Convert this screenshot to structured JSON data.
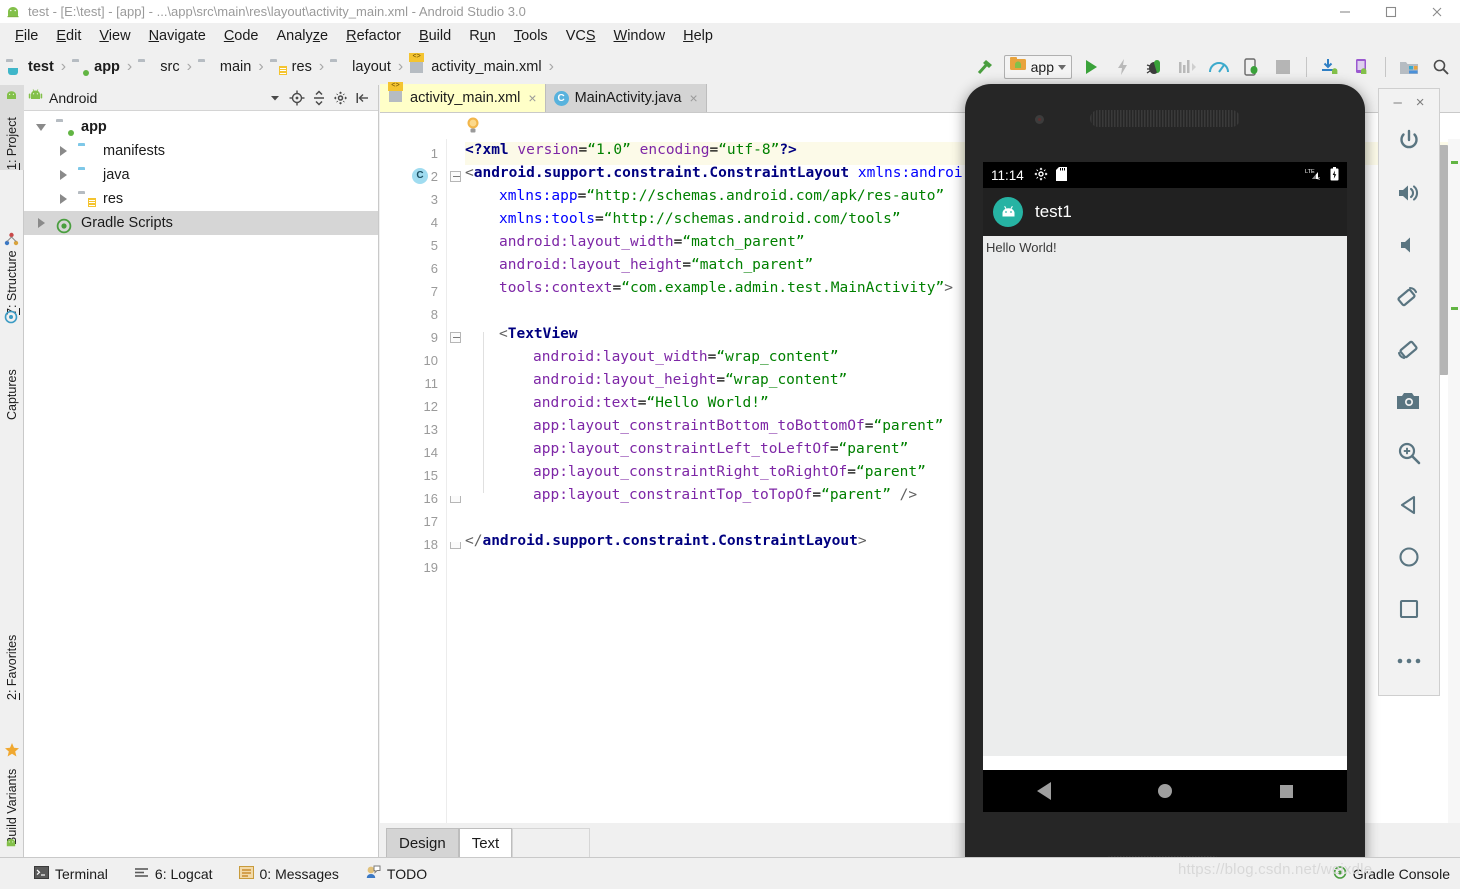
{
  "window": {
    "title": "test - [E:\\test] - [app] - ...\\app\\src\\main\\res\\layout\\activity_main.xml - Android Studio 3.0",
    "icon": "android-studio-icon",
    "controls": {
      "minimize": "minimize-icon",
      "maximize": "maximize-icon",
      "close": "close-icon"
    }
  },
  "menubar": {
    "items": [
      {
        "label": "File",
        "mnemonic": "F"
      },
      {
        "label": "Edit",
        "mnemonic": "E"
      },
      {
        "label": "View",
        "mnemonic": "V"
      },
      {
        "label": "Navigate",
        "mnemonic": "N"
      },
      {
        "label": "Code",
        "mnemonic": "C"
      },
      {
        "label": "Analyze",
        "mnemonic": "z"
      },
      {
        "label": "Refactor",
        "mnemonic": "R"
      },
      {
        "label": "Build",
        "mnemonic": "B"
      },
      {
        "label": "Run",
        "mnemonic": "u"
      },
      {
        "label": "Tools",
        "mnemonic": "T"
      },
      {
        "label": "VCS",
        "mnemonic": "S"
      },
      {
        "label": "Window",
        "mnemonic": "W"
      },
      {
        "label": "Help",
        "mnemonic": "H"
      }
    ]
  },
  "breadcrumb": {
    "items": [
      {
        "label": "test",
        "icon": "module-icon",
        "bold": true
      },
      {
        "label": "app",
        "icon": "app-module-icon",
        "bold": true
      },
      {
        "label": "src",
        "icon": "folder-icon",
        "bold": false
      },
      {
        "label": "main",
        "icon": "folder-icon",
        "bold": false
      },
      {
        "label": "res",
        "icon": "res-folder-icon",
        "bold": false
      },
      {
        "label": "layout",
        "icon": "layout-folder-icon",
        "bold": false
      },
      {
        "label": "activity_main.xml",
        "icon": "xml-file-icon",
        "bold": false
      }
    ],
    "separator": "›"
  },
  "toolbar": {
    "buttons": [
      {
        "name": "make-project-button",
        "icon": "hammer-icon"
      },
      {
        "name": "run-button",
        "icon": "play-icon"
      },
      {
        "name": "apply-changes-button",
        "icon": "lightning-icon"
      },
      {
        "name": "debug-button",
        "icon": "bug-icon"
      },
      {
        "name": "run-with-coverage-button",
        "icon": "coverage-icon"
      },
      {
        "name": "profile-button",
        "icon": "gauge-icon"
      },
      {
        "name": "attach-debugger-button",
        "icon": "attach-debugger-icon"
      },
      {
        "name": "stop-button",
        "icon": "stop-icon"
      },
      {
        "name": "sync-gradle-button",
        "icon": "sync-gradle-icon"
      },
      {
        "name": "avd-manager-button",
        "icon": "avd-manager-icon"
      },
      {
        "name": "sdk-manager-button",
        "icon": "sdk-manager-icon"
      },
      {
        "name": "search-everywhere-button",
        "icon": "search-icon"
      }
    ],
    "run_config": {
      "label": "app",
      "icon": "app-config-icon",
      "dropdown": "chevron-down-icon"
    }
  },
  "left_rail": {
    "tabs": [
      {
        "label": "1: Project",
        "mnemonic": "1",
        "icon": "android-icon",
        "selected": true
      },
      {
        "label": "7: Structure",
        "mnemonic": "7",
        "icon": "structure-icon",
        "selected": false
      },
      {
        "label": "Captures",
        "mnemonic": "",
        "icon": "captures-icon",
        "selected": false
      },
      {
        "label": "2: Favorites",
        "mnemonic": "2",
        "icon": "star-icon",
        "selected": false
      },
      {
        "label": "Build Variants",
        "mnemonic": "",
        "icon": "android-small-icon",
        "selected": false
      }
    ]
  },
  "project_panel": {
    "header": {
      "view": "Android",
      "dropdown": "chevron-down-icon",
      "buttons": [
        {
          "name": "select-opened-file-button",
          "icon": "target-icon"
        },
        {
          "name": "collapse-all-button",
          "icon": "collapse-all-icon"
        },
        {
          "name": "settings-button",
          "icon": "gear-icon"
        },
        {
          "name": "hide-button",
          "icon": "hide-panel-icon"
        }
      ]
    },
    "tree": [
      {
        "label": "app",
        "indent": 0,
        "expanded": true,
        "bold": true,
        "icon": "app-module-icon",
        "selected": false
      },
      {
        "label": "manifests",
        "indent": 1,
        "expanded": false,
        "bold": false,
        "icon": "folder-blue-icon",
        "selected": false
      },
      {
        "label": "java",
        "indent": 1,
        "expanded": false,
        "bold": false,
        "icon": "folder-blue-icon",
        "selected": false
      },
      {
        "label": "res",
        "indent": 1,
        "expanded": false,
        "bold": false,
        "icon": "res-folder-icon",
        "selected": false
      },
      {
        "label": "Gradle Scripts",
        "indent": 0,
        "expanded": false,
        "bold": false,
        "icon": "gradle-icon",
        "selected": true
      }
    ]
  },
  "editor": {
    "tabs": [
      {
        "label": "activity_main.xml",
        "icon": "xml-file-icon",
        "active": true,
        "close": "×"
      },
      {
        "label": "MainActivity.java",
        "icon": "java-class-icon",
        "active": false,
        "close": "×"
      }
    ],
    "hint_icon": "lightbulb-icon",
    "bottom_tabs": [
      {
        "label": "Design",
        "active": false
      },
      {
        "label": "Text",
        "active": true
      }
    ],
    "caret_line": 1,
    "gutter_marker_line": 2,
    "gutter_marker_text": "C",
    "lines": [
      {
        "n": 1,
        "indent": 0,
        "tokens": [
          {
            "t": "<?xml ",
            "c": "tok-pi"
          },
          {
            "t": "version",
            "c": "tok-attr"
          },
          {
            "t": "=",
            "c": "tok-plain"
          },
          {
            "t": "“1.0”",
            "c": "tok-str"
          },
          {
            "t": " ",
            "c": "tok-plain"
          },
          {
            "t": "encoding",
            "c": "tok-attr"
          },
          {
            "t": "=",
            "c": "tok-plain"
          },
          {
            "t": "“utf-8”",
            "c": "tok-str"
          },
          {
            "t": "?>",
            "c": "tok-pi"
          }
        ]
      },
      {
        "n": 2,
        "indent": 0,
        "tokens": [
          {
            "t": "<",
            "c": "tok-br"
          },
          {
            "t": "android.support.constraint.ConstraintLayout",
            "c": "tok-tag"
          },
          {
            "t": " ",
            "c": "tok-plain"
          },
          {
            "t": "xmlns:androi",
            "c": "tok-ns"
          }
        ]
      },
      {
        "n": 3,
        "indent": 1,
        "tokens": [
          {
            "t": "xmlns:app",
            "c": "tok-ns"
          },
          {
            "t": "=",
            "c": "tok-plain"
          },
          {
            "t": "“http://schemas.android.com/apk/res-auto”",
            "c": "tok-str"
          }
        ]
      },
      {
        "n": 4,
        "indent": 1,
        "tokens": [
          {
            "t": "xmlns:tools",
            "c": "tok-ns"
          },
          {
            "t": "=",
            "c": "tok-plain"
          },
          {
            "t": "“http://schemas.android.com/tools”",
            "c": "tok-str"
          }
        ]
      },
      {
        "n": 5,
        "indent": 1,
        "tokens": [
          {
            "t": "android:layout_width",
            "c": "tok-attr"
          },
          {
            "t": "=",
            "c": "tok-plain"
          },
          {
            "t": "“match_parent”",
            "c": "tok-str"
          }
        ]
      },
      {
        "n": 6,
        "indent": 1,
        "tokens": [
          {
            "t": "android:layout_height",
            "c": "tok-attr"
          },
          {
            "t": "=",
            "c": "tok-plain"
          },
          {
            "t": "“match_parent”",
            "c": "tok-str"
          }
        ]
      },
      {
        "n": 7,
        "indent": 1,
        "tokens": [
          {
            "t": "tools:context",
            "c": "tok-attr"
          },
          {
            "t": "=",
            "c": "tok-plain"
          },
          {
            "t": "“com.example.admin.test.MainActivity”",
            "c": "tok-str"
          },
          {
            "t": ">",
            "c": "tok-br"
          }
        ]
      },
      {
        "n": 8,
        "indent": 0,
        "tokens": []
      },
      {
        "n": 9,
        "indent": 1,
        "tokens": [
          {
            "t": "<",
            "c": "tok-br"
          },
          {
            "t": "TextView",
            "c": "tok-tag"
          }
        ]
      },
      {
        "n": 10,
        "indent": 2,
        "tokens": [
          {
            "t": "android:layout_width",
            "c": "tok-attr"
          },
          {
            "t": "=",
            "c": "tok-plain"
          },
          {
            "t": "“wrap_content”",
            "c": "tok-str"
          }
        ]
      },
      {
        "n": 11,
        "indent": 2,
        "tokens": [
          {
            "t": "android:layout_height",
            "c": "tok-attr"
          },
          {
            "t": "=",
            "c": "tok-plain"
          },
          {
            "t": "“wrap_content”",
            "c": "tok-str"
          }
        ]
      },
      {
        "n": 12,
        "indent": 2,
        "tokens": [
          {
            "t": "android:text",
            "c": "tok-attr"
          },
          {
            "t": "=",
            "c": "tok-plain"
          },
          {
            "t": "“Hello World!”",
            "c": "tok-str"
          }
        ]
      },
      {
        "n": 13,
        "indent": 2,
        "tokens": [
          {
            "t": "app:layout_constraintBottom_toBottomOf",
            "c": "tok-attr"
          },
          {
            "t": "=",
            "c": "tok-plain"
          },
          {
            "t": "“parent”",
            "c": "tok-str"
          }
        ]
      },
      {
        "n": 14,
        "indent": 2,
        "tokens": [
          {
            "t": "app:layout_constraintLeft_toLeftOf",
            "c": "tok-attr"
          },
          {
            "t": "=",
            "c": "tok-plain"
          },
          {
            "t": "“parent”",
            "c": "tok-str"
          }
        ]
      },
      {
        "n": 15,
        "indent": 2,
        "tokens": [
          {
            "t": "app:layout_constraintRight_toRightOf",
            "c": "tok-attr"
          },
          {
            "t": "=",
            "c": "tok-plain"
          },
          {
            "t": "“parent”",
            "c": "tok-str"
          }
        ]
      },
      {
        "n": 16,
        "indent": 2,
        "tokens": [
          {
            "t": "app:layout_constraintTop_toTopOf",
            "c": "tok-attr"
          },
          {
            "t": "=",
            "c": "tok-plain"
          },
          {
            "t": "“parent”",
            "c": "tok-str"
          },
          {
            "t": " ",
            "c": "tok-plain"
          },
          {
            "t": "/>",
            "c": "tok-br"
          }
        ]
      },
      {
        "n": 17,
        "indent": 0,
        "tokens": []
      },
      {
        "n": 18,
        "indent": 0,
        "tokens": [
          {
            "t": "</",
            "c": "tok-br"
          },
          {
            "t": "android.support.constraint.ConstraintLayout",
            "c": "tok-tag"
          },
          {
            "t": ">",
            "c": "tok-br"
          }
        ]
      },
      {
        "n": 19,
        "indent": 0,
        "tokens": []
      }
    ]
  },
  "statusbar": {
    "items": [
      {
        "label": "Terminal",
        "mnemonic": "",
        "icon": "terminal-icon"
      },
      {
        "label": "6: Logcat",
        "mnemonic": "6",
        "icon": "logcat-icon"
      },
      {
        "label": "0: Messages",
        "mnemonic": "0",
        "icon": "messages-icon"
      },
      {
        "label": "TODO",
        "mnemonic": "",
        "icon": "todo-icon"
      }
    ],
    "right": {
      "label": "Gradle Console",
      "icon": "gradle-console-icon"
    }
  },
  "emulator": {
    "window_controls": {
      "minimize": "–",
      "close": "×"
    },
    "device": {
      "status_bar": {
        "time": "11:14",
        "icons": [
          "gear-icon",
          "sdcard-icon"
        ],
        "right_icons": [
          "lte-signal-icon",
          "battery-icon"
        ]
      },
      "app_bar": {
        "title": "test1",
        "icon": "android-app-icon"
      },
      "content": {
        "text": "Hello World!"
      },
      "nav_bar": {
        "back": "back-triangle-icon",
        "home": "home-circle-icon",
        "recents": "recents-square-icon"
      }
    },
    "side_buttons": [
      {
        "name": "power-button",
        "icon": "power-icon"
      },
      {
        "name": "volume-up-button",
        "icon": "volume-up-icon"
      },
      {
        "name": "volume-down-button",
        "icon": "volume-down-icon"
      },
      {
        "name": "rotate-left-button",
        "icon": "rotate-left-icon"
      },
      {
        "name": "rotate-right-button",
        "icon": "rotate-right-icon"
      },
      {
        "name": "screenshot-button",
        "icon": "camera-icon"
      },
      {
        "name": "zoom-button",
        "icon": "zoom-in-icon"
      },
      {
        "name": "back-button",
        "icon": "back-triangle-icon"
      },
      {
        "name": "home-button",
        "icon": "home-circle-icon"
      },
      {
        "name": "overview-button",
        "icon": "recents-square-icon"
      },
      {
        "name": "extended-controls-button",
        "icon": "more-dots-icon"
      }
    ]
  },
  "watermark": {
    "text": "https://blog.csdn.net/weixdle"
  },
  "colors": {
    "accent_green": "#62b543",
    "tab_active_bg": "#ffffc8",
    "panel_bg": "#f0f0f0",
    "emulator_body": "#262626",
    "app_bar": "#212121",
    "app_icon_teal": "#26b3a3"
  }
}
